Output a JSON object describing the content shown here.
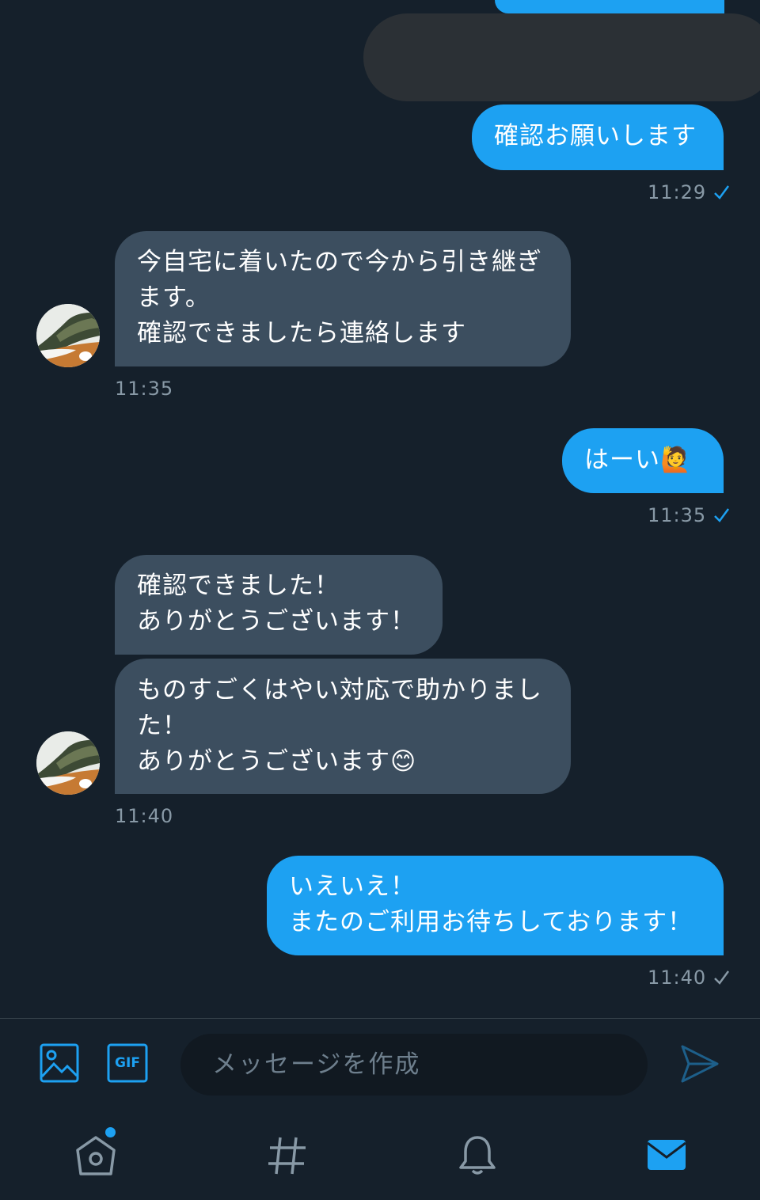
{
  "messages": [
    {
      "text": "確認お願いします"
    },
    {
      "text": "今自宅に着いたので今から引き継ぎ\nます。\n確認できましたら連絡します"
    },
    {
      "text": "はーい🙋"
    },
    {
      "text": "確認できました！\nありがとうございます！"
    },
    {
      "text": "ものすごくはやい対応で助かりまし\nた！\nありがとうございます😊"
    },
    {
      "text": "いえいえ！\nまたのご利用お待ちしております！"
    }
  ],
  "timestamps": {
    "t1": "11:29",
    "t2": "11:35",
    "t3": "11:35",
    "t4": "11:40",
    "t5": "11:40"
  },
  "compose": {
    "placeholder": "メッセージを作成",
    "gif_label": "GIF"
  },
  "icons": {
    "image": "image-icon",
    "gif": "gif-icon",
    "send": "send-icon",
    "home": "home-icon",
    "explore": "hashtag-icon",
    "notifications": "bell-icon",
    "messages": "mail-icon",
    "read_receipt": "check-icon"
  },
  "colors": {
    "background": "#15202b",
    "outgoing_bubble": "#1da1f2",
    "incoming_bubble": "#3c4e5f",
    "accent": "#1da1f2",
    "muted_text": "#8899a6"
  }
}
